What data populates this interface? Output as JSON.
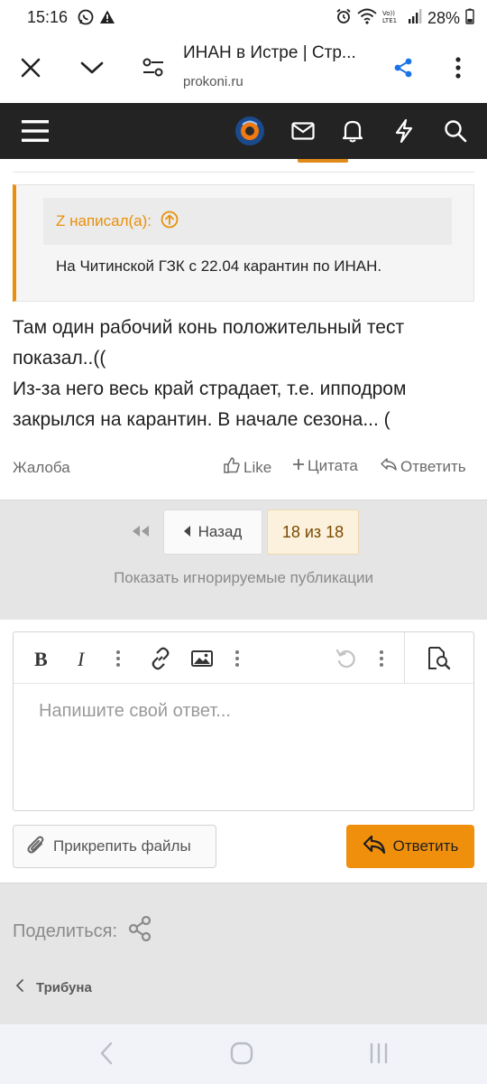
{
  "status_bar": {
    "time": "15:16",
    "battery": "28%",
    "icons": [
      "whatsapp-icon",
      "warning-icon",
      "alarm-icon",
      "wifi-icon",
      "volte-icon",
      "signal-icon",
      "battery-icon"
    ]
  },
  "browser": {
    "title": "ИНАН в Истре | Стр...",
    "url": "prokoni.ru",
    "icons": [
      "close-icon",
      "chevron-down-icon",
      "page-settings-icon",
      "share-icon",
      "more-icon"
    ]
  },
  "site_nav": {
    "icons": [
      "menu-icon",
      "avatar",
      "envelope-icon",
      "bell-icon",
      "bolt-icon",
      "search-icon"
    ]
  },
  "quote": {
    "author": "Z написал(а):",
    "text": "На Читинской ГЗК с 22.04 карантин по ИНАН."
  },
  "post": {
    "lines": [
      "Там один рабочий конь положительный тест показал..((",
      "Из-за него весь край страдает, т.е. ипподром закрылся на карантин. В начале сезона... ("
    ],
    "report": "Жалоба",
    "like": "Like",
    "quote": "Цитата",
    "reply": "Ответить"
  },
  "pagination": {
    "prev_label": "Назад",
    "current": "18 из 18",
    "show_ignored": "Показать игнорируемые публикации"
  },
  "editor": {
    "placeholder": "Напишите свой ответ...",
    "toolbar_icons": [
      "bold-icon",
      "italic-icon",
      "more-icon",
      "link-icon",
      "image-icon",
      "more-icon",
      "undo-icon",
      "more-icon",
      "preview-icon"
    ]
  },
  "buttons": {
    "attach": "Прикрепить файлы",
    "reply": "Ответить"
  },
  "footer": {
    "share_label": "Поделиться:",
    "breadcrumb": "Трибуна"
  },
  "colors": {
    "accent": "#ef8f0c",
    "nav_bg": "#232323",
    "gray_bg": "#e5e5e5"
  }
}
